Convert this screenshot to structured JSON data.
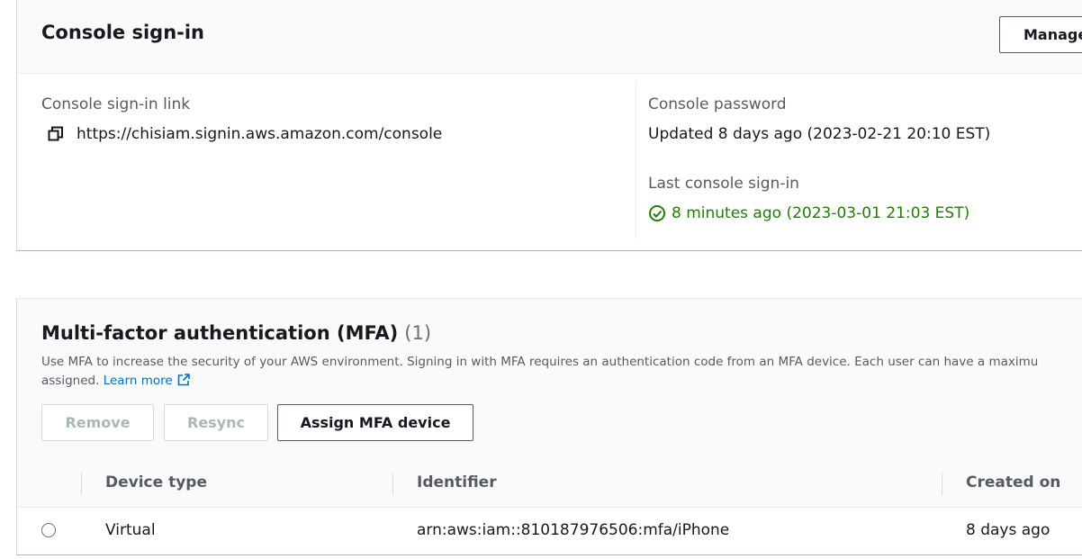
{
  "signin": {
    "title": "Console sign-in",
    "manage_label": "Manage",
    "link_label": "Console sign-in link",
    "link_value": "https://chisiam.signin.aws.amazon.com/console",
    "password_label": "Console password",
    "password_value": "Updated 8 days ago (2023-02-21 20:10 EST)",
    "last_signin_label": "Last console sign-in",
    "last_signin_value": "8 minutes ago (2023-03-01 21:03 EST)",
    "success_color": "#1d8102",
    "icons": {
      "copy": "copy-icon",
      "status": "check-circle-icon"
    }
  },
  "mfa": {
    "title": "Multi-factor authentication (MFA)",
    "count": "(1)",
    "description_line1": "Use MFA to increase the security of your AWS environment. Signing in with MFA requires an authentication code from an MFA device. Each user can have a maximu",
    "description_line2": "assigned.",
    "learn_more": "Learn more",
    "link_color": "#0073bb",
    "buttons": {
      "remove": "Remove",
      "resync": "Resync",
      "assign": "Assign MFA device"
    },
    "table": {
      "columns": [
        "Device type",
        "Identifier",
        "Created on"
      ],
      "rows": [
        {
          "device_type": "Virtual",
          "identifier": "arn:aws:iam::810187976506:mfa/iPhone",
          "created_on": "8 days ago",
          "selected": false
        }
      ]
    }
  }
}
